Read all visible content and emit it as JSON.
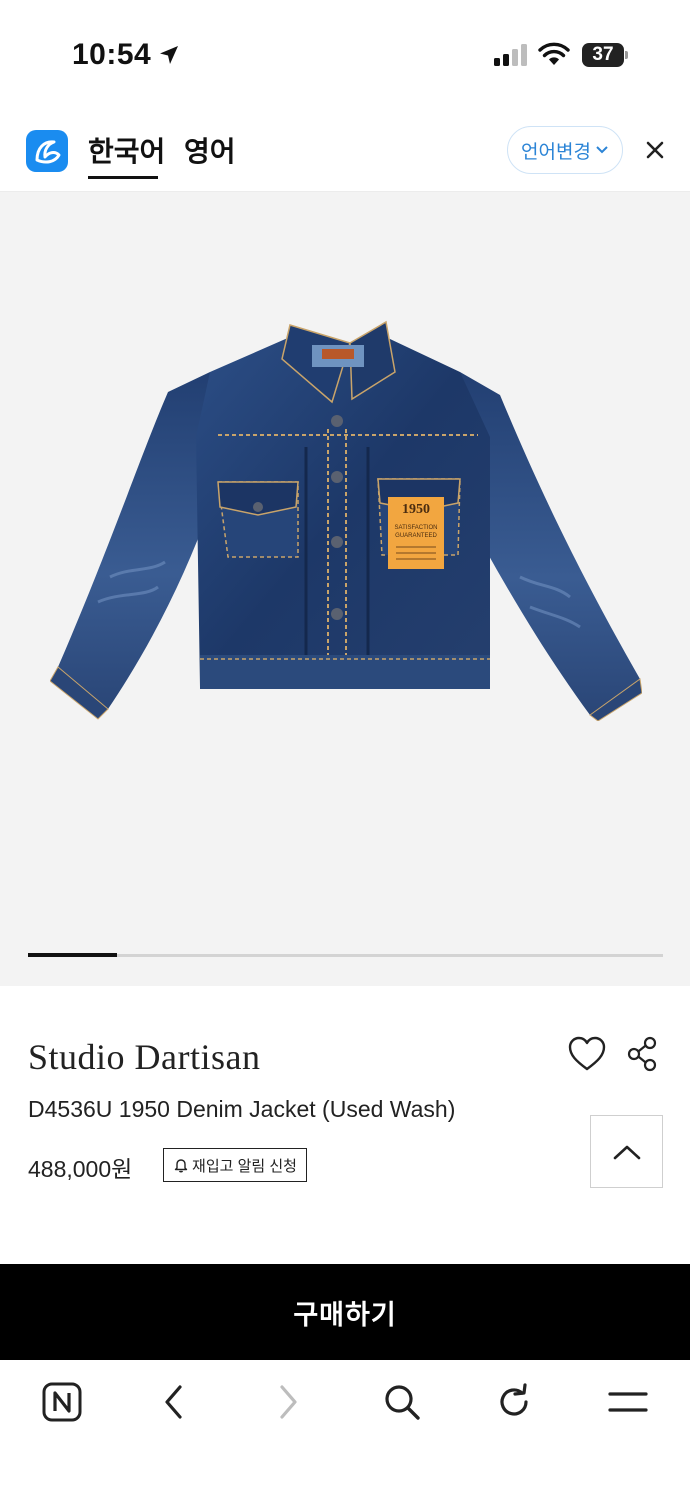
{
  "status_bar": {
    "time": "10:54",
    "battery": "37",
    "icons": [
      "location-arrow-icon",
      "cellular-signal-icon",
      "wifi-icon",
      "battery-icon"
    ]
  },
  "translate_bar": {
    "tabs": [
      {
        "label": "한국어",
        "active": true
      },
      {
        "label": "영어",
        "active": false
      }
    ],
    "language_change": "언어변경",
    "accent_color": "#1a8cf0"
  },
  "carousel": {
    "progress": 0.14
  },
  "product": {
    "brand": "Studio Dartisan",
    "name": "D4536U 1950 Denim Jacket (Used Wash)",
    "price": "488,000원",
    "restock_label": "재입고 알림 신청",
    "patch_text": [
      "1950",
      "SATISFACTION",
      "GUARANTEED"
    ]
  },
  "buy_button": {
    "label": "구매하기"
  },
  "toolbar": {
    "items": [
      "naver-n-icon",
      "back-arrow-icon",
      "forward-arrow-icon",
      "search-icon",
      "refresh-icon",
      "menu-icon"
    ]
  }
}
